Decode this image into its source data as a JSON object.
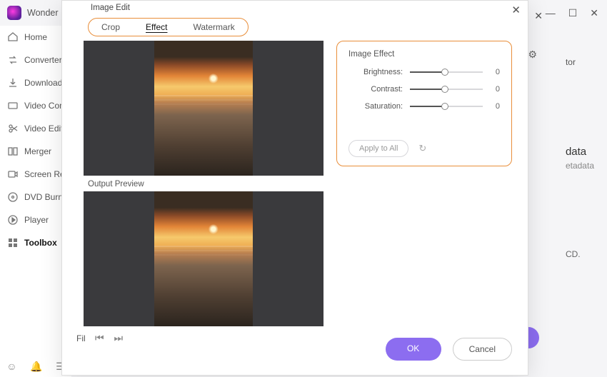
{
  "app": {
    "title": "Wonder"
  },
  "window_buttons": {
    "close": "✕",
    "max": "☐",
    "min": "—"
  },
  "sidebar": {
    "items": [
      {
        "label": "Home"
      },
      {
        "label": "Converter"
      },
      {
        "label": "Download"
      },
      {
        "label": "Video Compressor"
      },
      {
        "label": "Video Editor"
      },
      {
        "label": "Merger"
      },
      {
        "label": "Screen Recorder"
      },
      {
        "label": "DVD Burner"
      },
      {
        "label": "Player"
      },
      {
        "label": "Toolbox"
      }
    ]
  },
  "ghost": {
    "tor": "tor",
    "meta_title": "data",
    "meta_sub": "etadata",
    "cd": "CD."
  },
  "modal": {
    "title": "Image Edit",
    "tabs": {
      "crop": "Crop",
      "effect": "Effect",
      "watermark": "Watermark",
      "active": "effect"
    },
    "output_label": "Output Preview",
    "effect": {
      "heading": "Image Effect",
      "sliders": [
        {
          "label": "Brightness:",
          "value": 0,
          "pos": 48
        },
        {
          "label": "Contrast:",
          "value": 0,
          "pos": 48
        },
        {
          "label": "Saturation:",
          "value": 0,
          "pos": 48
        }
      ],
      "apply_all": "Apply to All"
    },
    "file_prefix": "Fil",
    "buttons": {
      "ok": "OK",
      "cancel": "Cancel"
    }
  }
}
